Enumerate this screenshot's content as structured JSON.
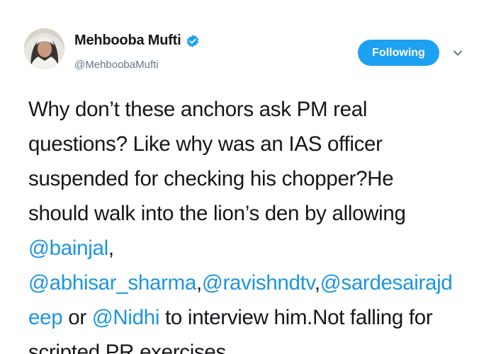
{
  "user": {
    "display_name": "Mehbooba Mufti",
    "handle": "@MehboobaMufti",
    "verified": true,
    "avatar_icon": "user-avatar"
  },
  "actions": {
    "follow_label": "Following",
    "menu_icon": "chevron-down-icon"
  },
  "colors": {
    "accent": "#1da1f2",
    "mention": "#1b95e0",
    "text": "#14171a",
    "muted": "#657786"
  },
  "tweet": {
    "lines": [
      [
        {
          "t": "Why don’t these anchors ask PM real"
        }
      ],
      [
        {
          "t": "questions? Like why was an IAS officer"
        }
      ],
      [
        {
          "t": "suspended for checking his chopper?He"
        }
      ],
      [
        {
          "t": "should walk into the lion’s den by allowing"
        }
      ],
      [
        {
          "t": "@bainjal",
          "m": true
        },
        {
          "t": ","
        }
      ],
      [
        {
          "t": "@abhisar_sharma",
          "m": true
        },
        {
          "t": ","
        },
        {
          "t": "@ravishndtv",
          "m": true
        },
        {
          "t": ","
        },
        {
          "t": "@sardesairajd",
          "m": true
        }
      ],
      [
        {
          "t": "eep",
          "m": true
        },
        {
          "t": " or "
        },
        {
          "t": "@Nidhi",
          "m": true
        },
        {
          "t": " to interview him.Not falling for"
        }
      ],
      [
        {
          "t": "scripted PR exercises"
        }
      ]
    ]
  }
}
